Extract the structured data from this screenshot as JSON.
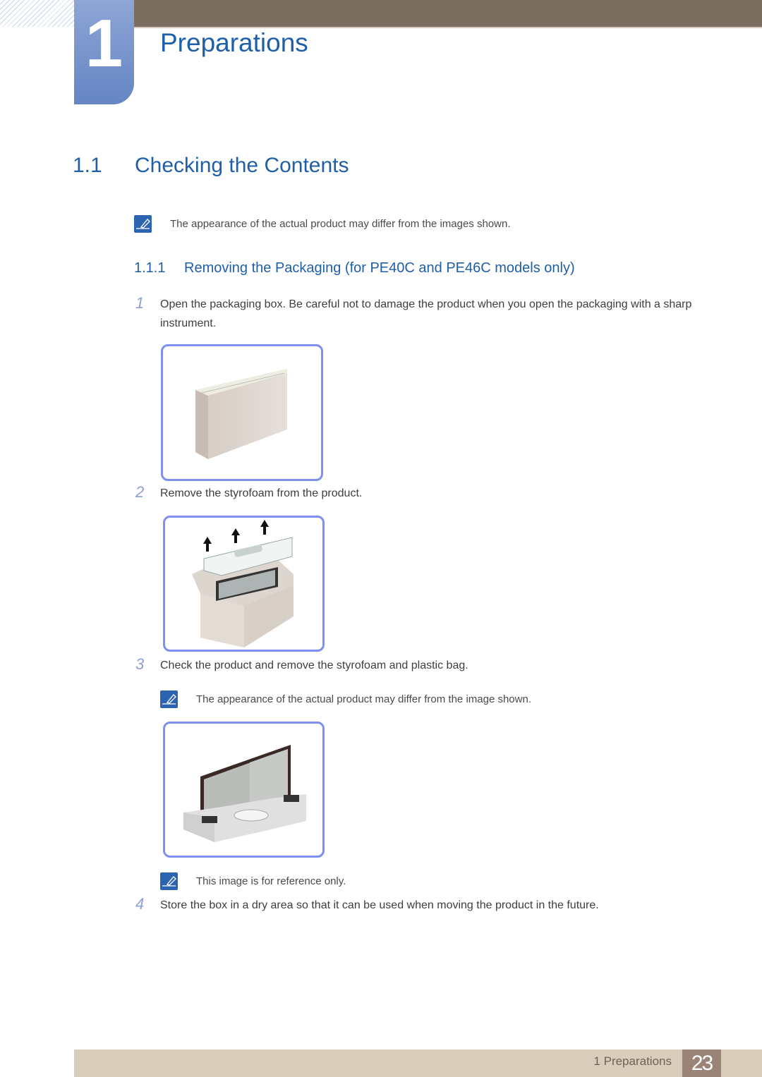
{
  "chapter": {
    "number": "1",
    "title": "Preparations"
  },
  "section": {
    "number": "1.1",
    "title": "Checking the Contents"
  },
  "notes": [
    "The appearance of the actual product may differ from the images shown.",
    "The appearance of the actual product may differ from the image shown.",
    "This image is for reference only."
  ],
  "subsection": {
    "number": "1.1.1",
    "title": "Removing the Packaging (for PE40C and PE46C models only)"
  },
  "steps": [
    {
      "n": "1",
      "text": "Open the packaging box. Be careful not to damage the product when you open the packaging with a sharp instrument."
    },
    {
      "n": "2",
      "text": "Remove the styrofoam from the product."
    },
    {
      "n": "3",
      "text": "Check the product and remove the styrofoam and plastic bag."
    },
    {
      "n": "4",
      "text": "Store the box in a dry area so that it can be used when moving the product in the future."
    }
  ],
  "figures": [
    {
      "icon": "closed-box-illustration"
    },
    {
      "icon": "styrofoam-removal-illustration"
    },
    {
      "icon": "display-in-styrofoam-illustration"
    }
  ],
  "footer": {
    "label": "1 Preparations",
    "page": "23"
  },
  "colors": {
    "accent": "#1f5fa8",
    "topbar": "#7b6e61",
    "frame": "#7d8ff0",
    "footer": "#d8ccba",
    "page_badge": "#9a8478"
  }
}
